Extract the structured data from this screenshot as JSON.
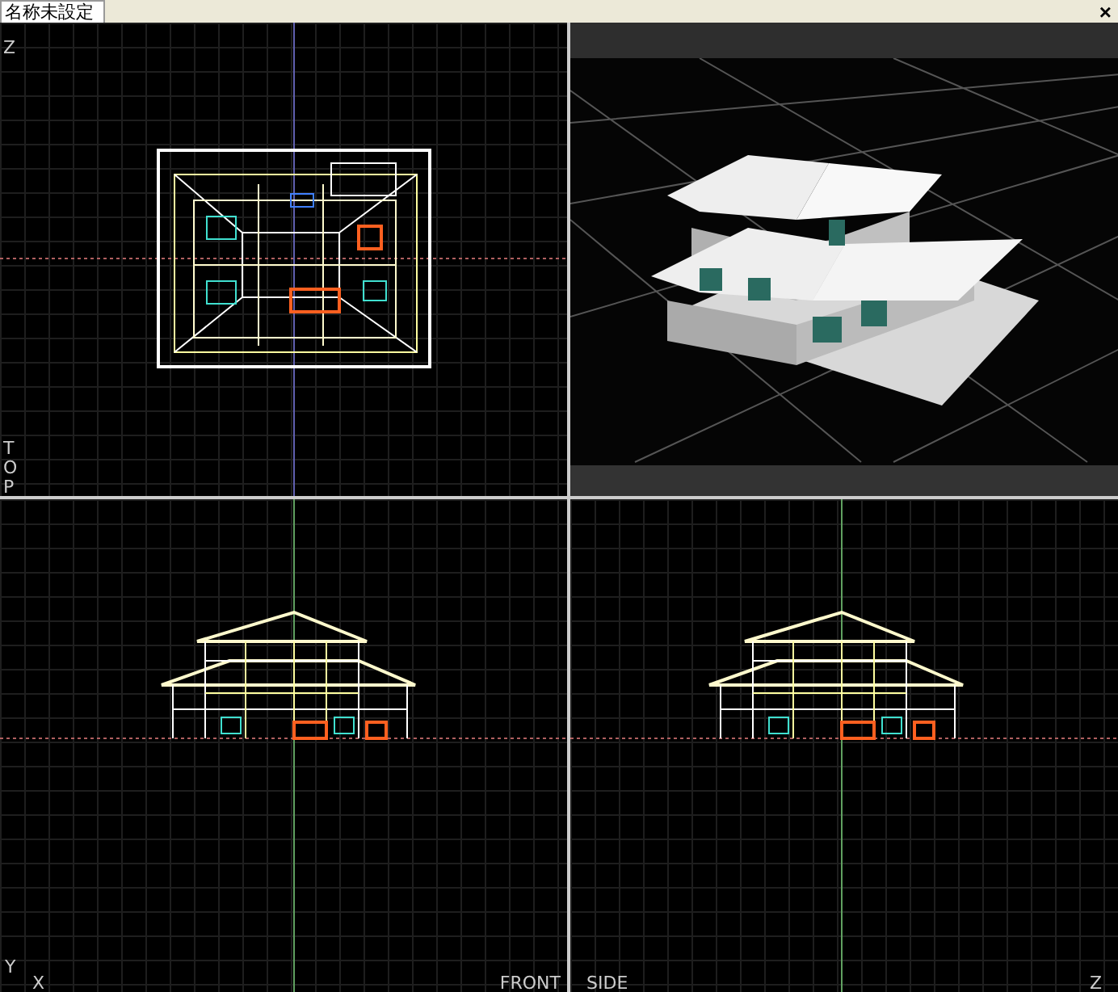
{
  "tab": {
    "label": "名称未設定",
    "selected": true
  },
  "close": "×",
  "viewports": [
    {
      "kind": "top",
      "axis_label": "Z",
      "view_label": "TOP"
    },
    {
      "kind": "perspective"
    },
    {
      "kind": "front",
      "axis_label": "Y",
      "x_label": "X",
      "view_label": "FRONT"
    },
    {
      "kind": "side",
      "view_label": "SIDE",
      "z_label": "Z"
    }
  ]
}
